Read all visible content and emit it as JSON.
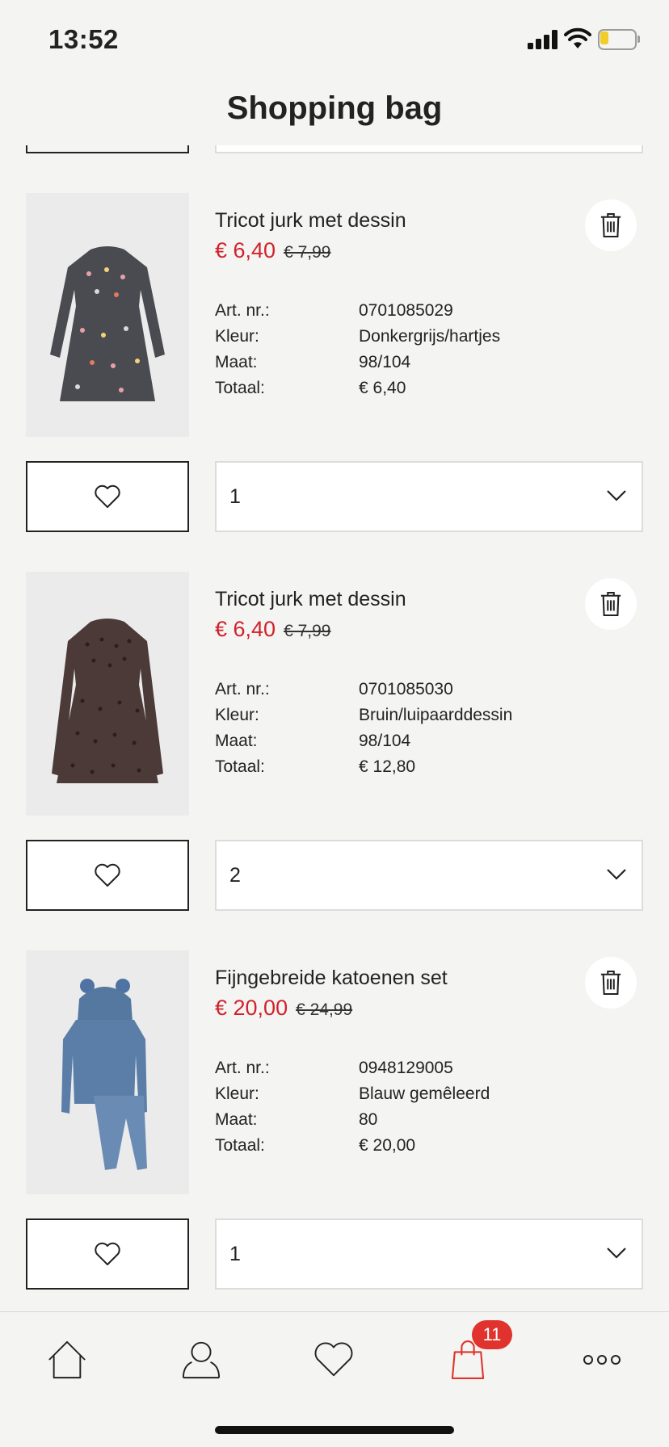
{
  "status_bar": {
    "time": "13:52",
    "battery_color": "#f2cc2a"
  },
  "header": {
    "title": "Shopping bag"
  },
  "labels": {
    "art_nr": "Art. nr.:",
    "kleur": "Kleur:",
    "maat": "Maat:",
    "totaal": "Totaal:"
  },
  "products": [
    {
      "name": "Tricot jurk met dessin",
      "price": "€ 6,40",
      "old_price": "€ 7,99",
      "art_nr": "0701085029",
      "kleur": "Donkergrijs/hartjes",
      "maat": "98/104",
      "totaal": "€ 6,40",
      "quantity": "1"
    },
    {
      "name": "Tricot jurk met dessin",
      "price": "€ 6,40",
      "old_price": "€ 7,99",
      "art_nr": "0701085030",
      "kleur": "Bruin/luipaarddessin",
      "maat": "98/104",
      "totaal": "€ 12,80",
      "quantity": "2"
    },
    {
      "name": "Fijngebreide katoenen set",
      "price": "€ 20,00",
      "old_price": "€ 24,99",
      "art_nr": "0948129005",
      "kleur": "Blauw gemêleerd",
      "maat": "80",
      "totaal": "€ 20,00",
      "quantity": "1"
    }
  ],
  "tab_bar": {
    "items": [
      "home-icon",
      "account-icon",
      "favourites-icon",
      "shopping-bag-icon",
      "more-icon"
    ],
    "cart_count": "11",
    "accent_color": "#e0332d"
  },
  "colors": {
    "sale_price": "#d1222b",
    "background": "#f4f4f2"
  }
}
